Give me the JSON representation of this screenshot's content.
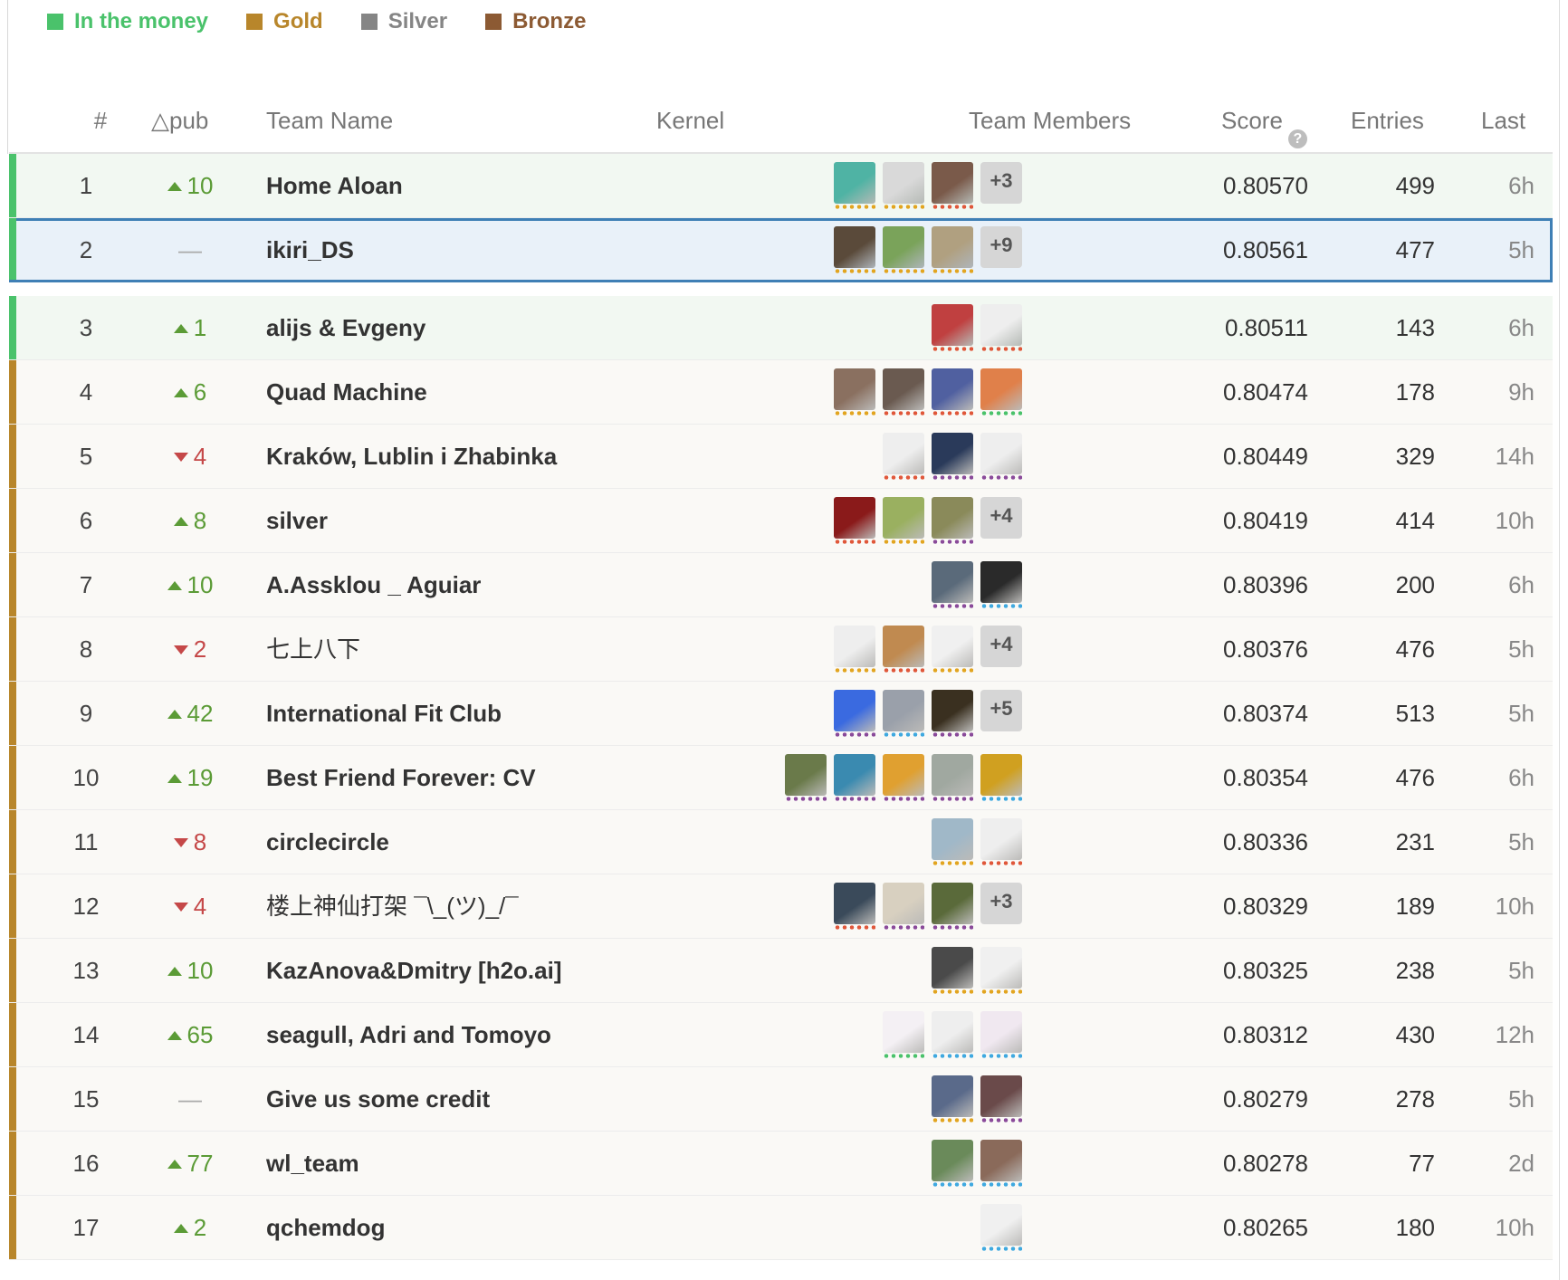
{
  "legend": [
    {
      "label": "In the money",
      "color": "#4ac26b"
    },
    {
      "label": "Gold",
      "color": "#b8862b"
    },
    {
      "label": "Silver",
      "color": "#858585"
    },
    {
      "label": "Bronze",
      "color": "#8c5a33"
    }
  ],
  "header": {
    "rank": "#",
    "delta": "△pub",
    "team_name": "Team Name",
    "kernel": "Kernel",
    "team_members": "Team Members",
    "score": "Score",
    "entries": "Entries",
    "last": "Last"
  },
  "rows": [
    {
      "rank": "1",
      "dir": "up",
      "delta": "10",
      "team": "Home Aloan",
      "score": "0.80570",
      "entries": "499",
      "last": "6h",
      "tier": "money",
      "members": [
        {
          "c": "#4fb3a4",
          "d": "#e2a520"
        },
        {
          "c": "#d9d9d9",
          "d": "#e2a520"
        },
        {
          "c": "#7a5a4a",
          "d": "#e0573a"
        }
      ],
      "more": "+3"
    },
    {
      "rank": "2",
      "dir": "none",
      "delta": "—",
      "team": "ikiri_DS",
      "score": "0.80561",
      "entries": "477",
      "last": "5h",
      "tier": "money",
      "selected": true,
      "members": [
        {
          "c": "#5a4a3a",
          "d": "#e2a520"
        },
        {
          "c": "#7aa35a",
          "d": "#e2a520"
        },
        {
          "c": "#b0a080",
          "d": "#e2a520"
        }
      ],
      "more": "+9"
    },
    {
      "rank": "3",
      "dir": "up",
      "delta": "1",
      "team": "alijs & Evgeny",
      "score": "0.80511",
      "entries": "143",
      "last": "6h",
      "tier": "money",
      "members": [
        {
          "c": "#c04040",
          "d": "#e0573a"
        },
        {
          "c": "#eeeeee",
          "d": "#e0573a"
        }
      ]
    },
    {
      "rank": "4",
      "dir": "up",
      "delta": "6",
      "team": "Quad Machine",
      "score": "0.80474",
      "entries": "178",
      "last": "9h",
      "tier": "gold",
      "members": [
        {
          "c": "#8a7060",
          "d": "#e2a520"
        },
        {
          "c": "#6a5a50",
          "d": "#e0573a"
        },
        {
          "c": "#5060a0",
          "d": "#e0573a"
        },
        {
          "c": "#e0804a",
          "d": "#4ac26b"
        }
      ]
    },
    {
      "rank": "5",
      "dir": "down",
      "delta": "4",
      "team": "Kraków, Lublin i Zhabinka",
      "score": "0.80449",
      "entries": "329",
      "last": "14h",
      "tier": "gold",
      "members": [
        {
          "c": "#eeeeee",
          "d": "#e0573a"
        },
        {
          "c": "#2a3a5a",
          "d": "#8a4a9a"
        },
        {
          "c": "#eeeeee",
          "d": "#8a4a9a"
        }
      ]
    },
    {
      "rank": "6",
      "dir": "up",
      "delta": "8",
      "team": "silver",
      "score": "0.80419",
      "entries": "414",
      "last": "10h",
      "tier": "gold",
      "members": [
        {
          "c": "#8a1a1a",
          "d": "#e0573a"
        },
        {
          "c": "#9ab060",
          "d": "#e2a520"
        },
        {
          "c": "#8a8a5a",
          "d": "#8a4a9a"
        }
      ],
      "more": "+4"
    },
    {
      "rank": "7",
      "dir": "up",
      "delta": "10",
      "team": "A.Assklou _ Aguiar",
      "score": "0.80396",
      "entries": "200",
      "last": "6h",
      "tier": "gold",
      "members": [
        {
          "c": "#5a6a7a",
          "d": "#8a4a9a"
        },
        {
          "c": "#2a2a2a",
          "d": "#3fa9e0"
        }
      ]
    },
    {
      "rank": "8",
      "dir": "down",
      "delta": "2",
      "team": "七上八下",
      "score": "0.80376",
      "entries": "476",
      "last": "5h",
      "tier": "gold",
      "cjk": true,
      "members": [
        {
          "c": "#eeeeee",
          "d": "#e2a520"
        },
        {
          "c": "#c08a50",
          "d": "#e0573a"
        },
        {
          "c": "#f0f0f0",
          "d": "#e2a520"
        }
      ],
      "more": "+4"
    },
    {
      "rank": "9",
      "dir": "up",
      "delta": "42",
      "team": "International Fit Club",
      "score": "0.80374",
      "entries": "513",
      "last": "5h",
      "tier": "gold",
      "members": [
        {
          "c": "#3a6ae0",
          "d": "#8a4a9a"
        },
        {
          "c": "#9aa0aa",
          "d": "#3fa9e0"
        },
        {
          "c": "#3a3020",
          "d": "#8a4a9a"
        }
      ],
      "more": "+5"
    },
    {
      "rank": "10",
      "dir": "up",
      "delta": "19",
      "team": "Best Friend Forever: CV",
      "score": "0.80354",
      "entries": "476",
      "last": "6h",
      "tier": "gold",
      "members": [
        {
          "c": "#6a7a4a",
          "d": "#8a4a9a"
        },
        {
          "c": "#3a8ab0",
          "d": "#8a4a9a"
        },
        {
          "c": "#e0a030",
          "d": "#8a4a9a"
        },
        {
          "c": "#a0a8a0",
          "d": "#8a4a9a"
        },
        {
          "c": "#d0a020",
          "d": "#3fa9e0"
        }
      ]
    },
    {
      "rank": "11",
      "dir": "down",
      "delta": "8",
      "team": "circlecircle",
      "score": "0.80336",
      "entries": "231",
      "last": "5h",
      "tier": "gold",
      "members": [
        {
          "c": "#a0b8c8",
          "d": "#e2a520"
        },
        {
          "c": "#eeeeee",
          "d": "#e0573a"
        }
      ]
    },
    {
      "rank": "12",
      "dir": "down",
      "delta": "4",
      "team": "楼上神仙打架 ¯\\_(ツ)_/¯",
      "score": "0.80329",
      "entries": "189",
      "last": "10h",
      "tier": "gold",
      "cjk": true,
      "members": [
        {
          "c": "#3a4a5a",
          "d": "#e0573a"
        },
        {
          "c": "#d8d0c0",
          "d": "#8a4a9a"
        },
        {
          "c": "#5a6a3a",
          "d": "#8a4a9a"
        }
      ],
      "more": "+3"
    },
    {
      "rank": "13",
      "dir": "up",
      "delta": "10",
      "team": "KazAnova&Dmitry [h2o.ai]",
      "score": "0.80325",
      "entries": "238",
      "last": "5h",
      "tier": "gold",
      "members": [
        {
          "c": "#4a4a4a",
          "d": "#e2a520"
        },
        {
          "c": "#f0f0f0",
          "d": "#e2a520"
        }
      ]
    },
    {
      "rank": "14",
      "dir": "up",
      "delta": "65",
      "team": "seagull, Adri and Tomoyo",
      "score": "0.80312",
      "entries": "430",
      "last": "12h",
      "tier": "gold",
      "members": [
        {
          "c": "#f4f0f4",
          "d": "#4ac26b"
        },
        {
          "c": "#eeeeee",
          "d": "#3fa9e0"
        },
        {
          "c": "#f0e8f0",
          "d": "#3fa9e0"
        }
      ]
    },
    {
      "rank": "15",
      "dir": "none",
      "delta": "—",
      "team": "Give us some credit",
      "score": "0.80279",
      "entries": "278",
      "last": "5h",
      "tier": "gold",
      "members": [
        {
          "c": "#5a6a8a",
          "d": "#e2a520"
        },
        {
          "c": "#6a4a4a",
          "d": "#8a4a9a"
        }
      ]
    },
    {
      "rank": "16",
      "dir": "up",
      "delta": "77",
      "team": "wl_team",
      "score": "0.80278",
      "entries": "77",
      "last": "2d",
      "tier": "gold",
      "members": [
        {
          "c": "#6a8a5a",
          "d": "#3fa9e0"
        },
        {
          "c": "#8a6a5a",
          "d": "#3fa9e0"
        }
      ]
    },
    {
      "rank": "17",
      "dir": "up",
      "delta": "2",
      "team": "qchemdog",
      "score": "0.80265",
      "entries": "180",
      "last": "10h",
      "tier": "gold",
      "members": [
        {
          "c": "#f0f0f0",
          "d": "#3fa9e0"
        }
      ]
    }
  ]
}
